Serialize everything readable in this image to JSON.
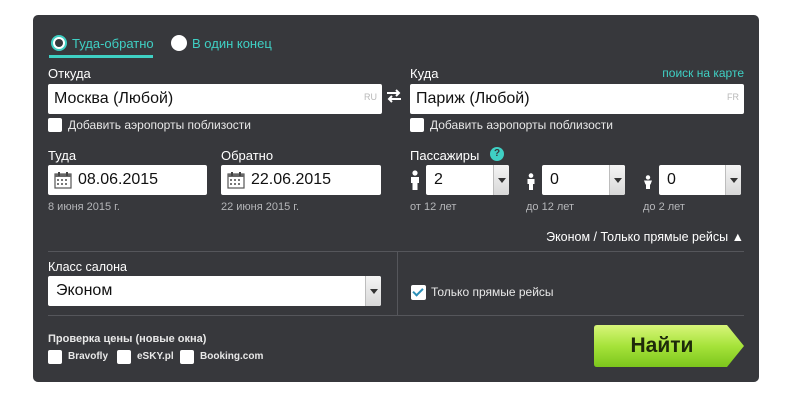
{
  "trip_type": {
    "round_trip": "Туда-обратно",
    "one_way": "В один конец",
    "selected": "round_trip"
  },
  "from": {
    "label": "Откуда",
    "value": "Москва (Любой)",
    "country": "RU",
    "nearby_label": "Добавить аэропорты поблизости",
    "nearby_checked": false
  },
  "to": {
    "label": "Куда",
    "value": "Париж (Любой)",
    "country": "FR",
    "nearby_label": "Добавить аэропорты поблизости",
    "nearby_checked": false
  },
  "map_search_link": "поиск на карте",
  "depart": {
    "label": "Туда",
    "value": "08.06.2015",
    "hint": "8 июня 2015 г."
  },
  "return": {
    "label": "Обратно",
    "value": "22.06.2015",
    "hint": "22 июня 2015 г."
  },
  "passengers": {
    "label": "Пассажиры",
    "help": "?",
    "adults": {
      "value": "2",
      "hint": "от 12 лет"
    },
    "children": {
      "value": "0",
      "hint": "до 12 лет"
    },
    "infants": {
      "value": "0",
      "hint": "до 2 лет"
    }
  },
  "summary_toggle": "Эконом / Только прямые рейсы ▲",
  "cabin": {
    "label": "Класс салона",
    "value": "Эконом"
  },
  "direct_only": {
    "label": "Только прямые рейсы",
    "checked": true
  },
  "price_check": {
    "label": "Проверка цены (новые окна)",
    "options": [
      "Bravofly",
      "eSKY.pl",
      "Booking.com"
    ]
  },
  "search_button": "Найти",
  "colors": {
    "panel": "#37383c",
    "accent": "#3fd0c4",
    "button_green": "#9be032"
  }
}
